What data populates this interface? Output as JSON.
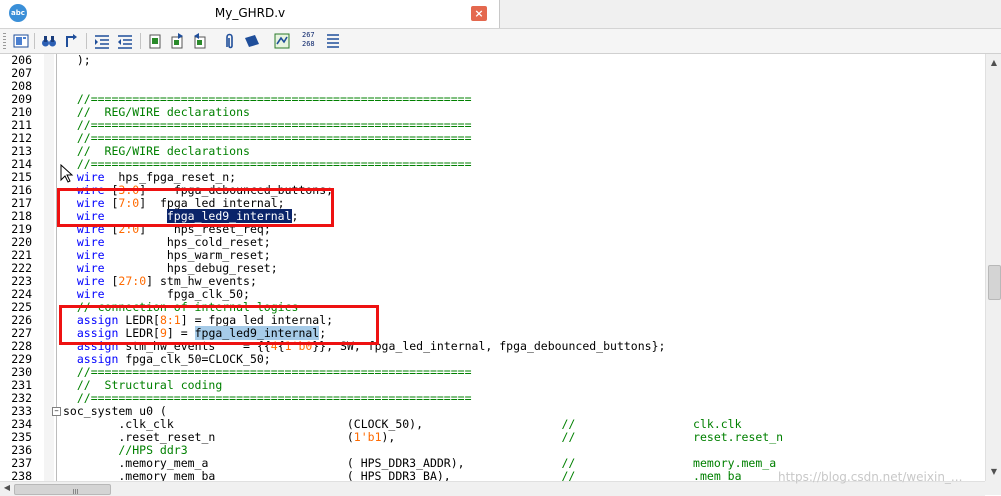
{
  "window": {
    "tab_title": "My_GHRD.v",
    "app_icon_text": "abc",
    "close_glyph": "×"
  },
  "toolbar": {
    "icons": [
      "document-map-icon",
      "find-icon",
      "goto-icon",
      "indent-icon",
      "outdent-icon",
      "bookmark-icon",
      "bookmark-prev-icon",
      "bookmark-next-icon",
      "paperclip-icon",
      "clear-marks-icon",
      "wrap-icon",
      "line-numbers-icon",
      "list-icon"
    ],
    "line_number_glyph_top": "267",
    "line_number_glyph_bottom": "268"
  },
  "editor": {
    "language": "Verilog",
    "lines": [
      {
        "n": "206",
        "segs": [
          {
            "t": "  );",
            "c": "plain"
          }
        ]
      },
      {
        "n": "207",
        "segs": []
      },
      {
        "n": "208",
        "segs": []
      },
      {
        "n": "209",
        "segs": [
          {
            "t": "  //=======================================================",
            "c": "cm"
          }
        ]
      },
      {
        "n": "210",
        "segs": [
          {
            "t": "  //  REG/WIRE declarations",
            "c": "cm"
          }
        ]
      },
      {
        "n": "211",
        "segs": [
          {
            "t": "  //=======================================================",
            "c": "cm"
          }
        ]
      },
      {
        "n": "212",
        "segs": [
          {
            "t": "  //=======================================================",
            "c": "cm"
          }
        ]
      },
      {
        "n": "213",
        "segs": [
          {
            "t": "  //  REG/WIRE declarations",
            "c": "cm"
          }
        ]
      },
      {
        "n": "214",
        "segs": [
          {
            "t": "  //=======================================================",
            "c": "cm"
          }
        ]
      },
      {
        "n": "215",
        "segs": [
          {
            "t": "  ",
            "c": "plain"
          },
          {
            "t": "wire",
            "c": "kw"
          },
          {
            "t": "  hps_fpga_reset_n;",
            "c": "plain"
          }
        ]
      },
      {
        "n": "216",
        "segs": [
          {
            "t": "  ",
            "c": "plain"
          },
          {
            "t": "wire",
            "c": "kw"
          },
          {
            "t": " [",
            "c": "plain"
          },
          {
            "t": "3:0",
            "c": "num"
          },
          {
            "t": "]    fpga_debounced_buttons;",
            "c": "plain"
          }
        ]
      },
      {
        "n": "217",
        "segs": [
          {
            "t": "  ",
            "c": "plain"
          },
          {
            "t": "wire",
            "c": "kw"
          },
          {
            "t": " [",
            "c": "plain"
          },
          {
            "t": "7:0",
            "c": "num"
          },
          {
            "t": "]  fpga_led_internal;",
            "c": "plain"
          }
        ]
      },
      {
        "n": "218",
        "segs": [
          {
            "t": "  ",
            "c": "plain"
          },
          {
            "t": "wire",
            "c": "kw"
          },
          {
            "t": "         ",
            "c": "plain"
          },
          {
            "t": "fpga_led9_internal",
            "c": "sel-dark"
          },
          {
            "t": ";",
            "c": "plain"
          }
        ]
      },
      {
        "n": "219",
        "segs": [
          {
            "t": "  ",
            "c": "plain"
          },
          {
            "t": "wire",
            "c": "kw"
          },
          {
            "t": " [",
            "c": "plain"
          },
          {
            "t": "2:0",
            "c": "num"
          },
          {
            "t": "]    hps_reset_req;",
            "c": "plain"
          }
        ]
      },
      {
        "n": "220",
        "segs": [
          {
            "t": "  ",
            "c": "plain"
          },
          {
            "t": "wire",
            "c": "kw"
          },
          {
            "t": "         hps_cold_reset;",
            "c": "plain"
          }
        ]
      },
      {
        "n": "221",
        "segs": [
          {
            "t": "  ",
            "c": "plain"
          },
          {
            "t": "wire",
            "c": "kw"
          },
          {
            "t": "         hps_warm_reset;",
            "c": "plain"
          }
        ]
      },
      {
        "n": "222",
        "segs": [
          {
            "t": "  ",
            "c": "plain"
          },
          {
            "t": "wire",
            "c": "kw"
          },
          {
            "t": "         hps_debug_reset;",
            "c": "plain"
          }
        ]
      },
      {
        "n": "223",
        "segs": [
          {
            "t": "  ",
            "c": "plain"
          },
          {
            "t": "wire",
            "c": "kw"
          },
          {
            "t": " [",
            "c": "plain"
          },
          {
            "t": "27:0",
            "c": "num"
          },
          {
            "t": "] stm_hw_events;",
            "c": "plain"
          }
        ]
      },
      {
        "n": "224",
        "segs": [
          {
            "t": "  ",
            "c": "plain"
          },
          {
            "t": "wire",
            "c": "kw"
          },
          {
            "t": "         fpga_clk_50;",
            "c": "plain"
          }
        ]
      },
      {
        "n": "225",
        "segs": [
          {
            "t": "  // connection of internal logics",
            "c": "cm"
          }
        ]
      },
      {
        "n": "226",
        "segs": [
          {
            "t": "  ",
            "c": "plain"
          },
          {
            "t": "assign",
            "c": "kw"
          },
          {
            "t": " LEDR[",
            "c": "plain"
          },
          {
            "t": "8:1",
            "c": "num"
          },
          {
            "t": "] = fpga_led_internal;",
            "c": "plain"
          }
        ]
      },
      {
        "n": "227",
        "segs": [
          {
            "t": "  ",
            "c": "plain"
          },
          {
            "t": "assign",
            "c": "kw"
          },
          {
            "t": " LEDR[",
            "c": "plain"
          },
          {
            "t": "9",
            "c": "num"
          },
          {
            "t": "] = ",
            "c": "plain"
          },
          {
            "t": "fpga_led9_internal",
            "c": "sel-light"
          },
          {
            "t": ";",
            "c": "plain"
          }
        ]
      },
      {
        "n": "228",
        "segs": [
          {
            "t": "  ",
            "c": "plain"
          },
          {
            "t": "assign",
            "c": "kw"
          },
          {
            "t": " stm_hw_events    = {{",
            "c": "plain"
          },
          {
            "t": "4",
            "c": "num"
          },
          {
            "t": "{",
            "c": "plain"
          },
          {
            "t": "1'b0",
            "c": "num"
          },
          {
            "t": "}}, SW, fpga_led_internal, fpga_debounced_buttons};",
            "c": "plain"
          }
        ]
      },
      {
        "n": "229",
        "segs": [
          {
            "t": "  ",
            "c": "plain"
          },
          {
            "t": "assign",
            "c": "kw"
          },
          {
            "t": " fpga_clk_50=CLOCK_50;",
            "c": "plain"
          }
        ]
      },
      {
        "n": "230",
        "segs": [
          {
            "t": "  //=======================================================",
            "c": "cm"
          }
        ]
      },
      {
        "n": "231",
        "segs": [
          {
            "t": "  //  Structural coding",
            "c": "cm"
          }
        ]
      },
      {
        "n": "232",
        "segs": [
          {
            "t": "  //=======================================================",
            "c": "cm"
          }
        ]
      },
      {
        "n": "233",
        "fold": "−",
        "segs": [
          {
            "t": "soc_system u0 (",
            "c": "plain"
          }
        ]
      },
      {
        "n": "234",
        "segs": [
          {
            "t": "        .clk_clk                         (CLOCK_50),                    ",
            "c": "plain"
          },
          {
            "t": "//                 clk.clk",
            "c": "cm"
          }
        ]
      },
      {
        "n": "235",
        "segs": [
          {
            "t": "        .reset_reset_n                   (",
            "c": "plain"
          },
          {
            "t": "1'b1",
            "c": "num"
          },
          {
            "t": "),                        ",
            "c": "plain"
          },
          {
            "t": "//                 reset.reset_n",
            "c": "cm"
          }
        ]
      },
      {
        "n": "236",
        "segs": [
          {
            "t": "        //HPS ddr3",
            "c": "cm"
          }
        ]
      },
      {
        "n": "237",
        "segs": [
          {
            "t": "        .memory_mem_a                    ( HPS_DDR3_ADDR),              ",
            "c": "plain"
          },
          {
            "t": "//                 memory.mem_a",
            "c": "cm"
          }
        ]
      },
      {
        "n": "238",
        "segs": [
          {
            "t": "        .memory_mem_ba                   ( HPS_DDR3_BA),                ",
            "c": "plain"
          },
          {
            "t": "//                 .mem_ba",
            "c": "cm"
          }
        ]
      }
    ]
  },
  "watermark": "https://blog.csdn.net/weixin_..."
}
